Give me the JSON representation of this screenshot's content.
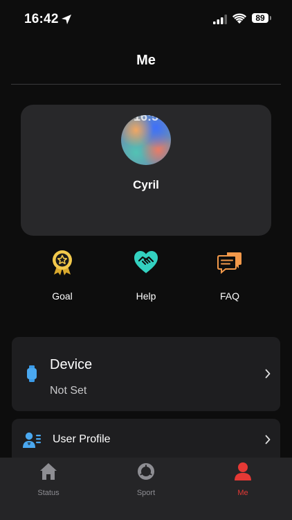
{
  "status_bar": {
    "time": "16:42",
    "battery": "89"
  },
  "header": {
    "title": "Me"
  },
  "profile": {
    "avatar_overlay_text": "16:5",
    "name": "Cyril"
  },
  "quick_actions": [
    {
      "label": "Goal",
      "icon": "medal-star-icon",
      "color": "#f2c94c"
    },
    {
      "label": "Help",
      "icon": "heart-handshake-icon",
      "color": "#33d1c0"
    },
    {
      "label": "FAQ",
      "icon": "chat-bubbles-icon",
      "color": "#f2994a"
    }
  ],
  "menu": {
    "device": {
      "title": "Device",
      "value": "Not Set",
      "icon": "smartwatch-icon"
    },
    "user_profile": {
      "label": "User Profile",
      "icon": "user-list-icon"
    }
  },
  "tabs": [
    {
      "label": "Status",
      "icon": "home-icon",
      "active": false
    },
    {
      "label": "Sport",
      "icon": "sport-ring-icon",
      "active": false
    },
    {
      "label": "Me",
      "icon": "person-icon",
      "active": true
    }
  ],
  "colors": {
    "accent": "#e53935",
    "inactive_tab": "#8e8e93",
    "card": "#28282a",
    "row": "#1e1e20"
  }
}
